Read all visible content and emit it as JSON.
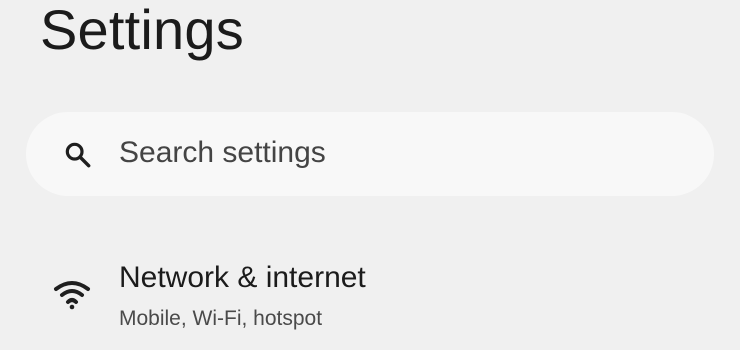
{
  "header": {
    "title": "Settings"
  },
  "search": {
    "icon": "search-icon",
    "placeholder": "Search settings"
  },
  "items": [
    {
      "icon": "wifi-icon",
      "title": "Network & internet",
      "subtitle": "Mobile, Wi-Fi, hotspot"
    }
  ],
  "colors": {
    "background": "#f0f0f0",
    "search_background": "#f8f8f8",
    "primary_text": "#1b1b1b",
    "secondary_text": "#4a4a4a"
  }
}
